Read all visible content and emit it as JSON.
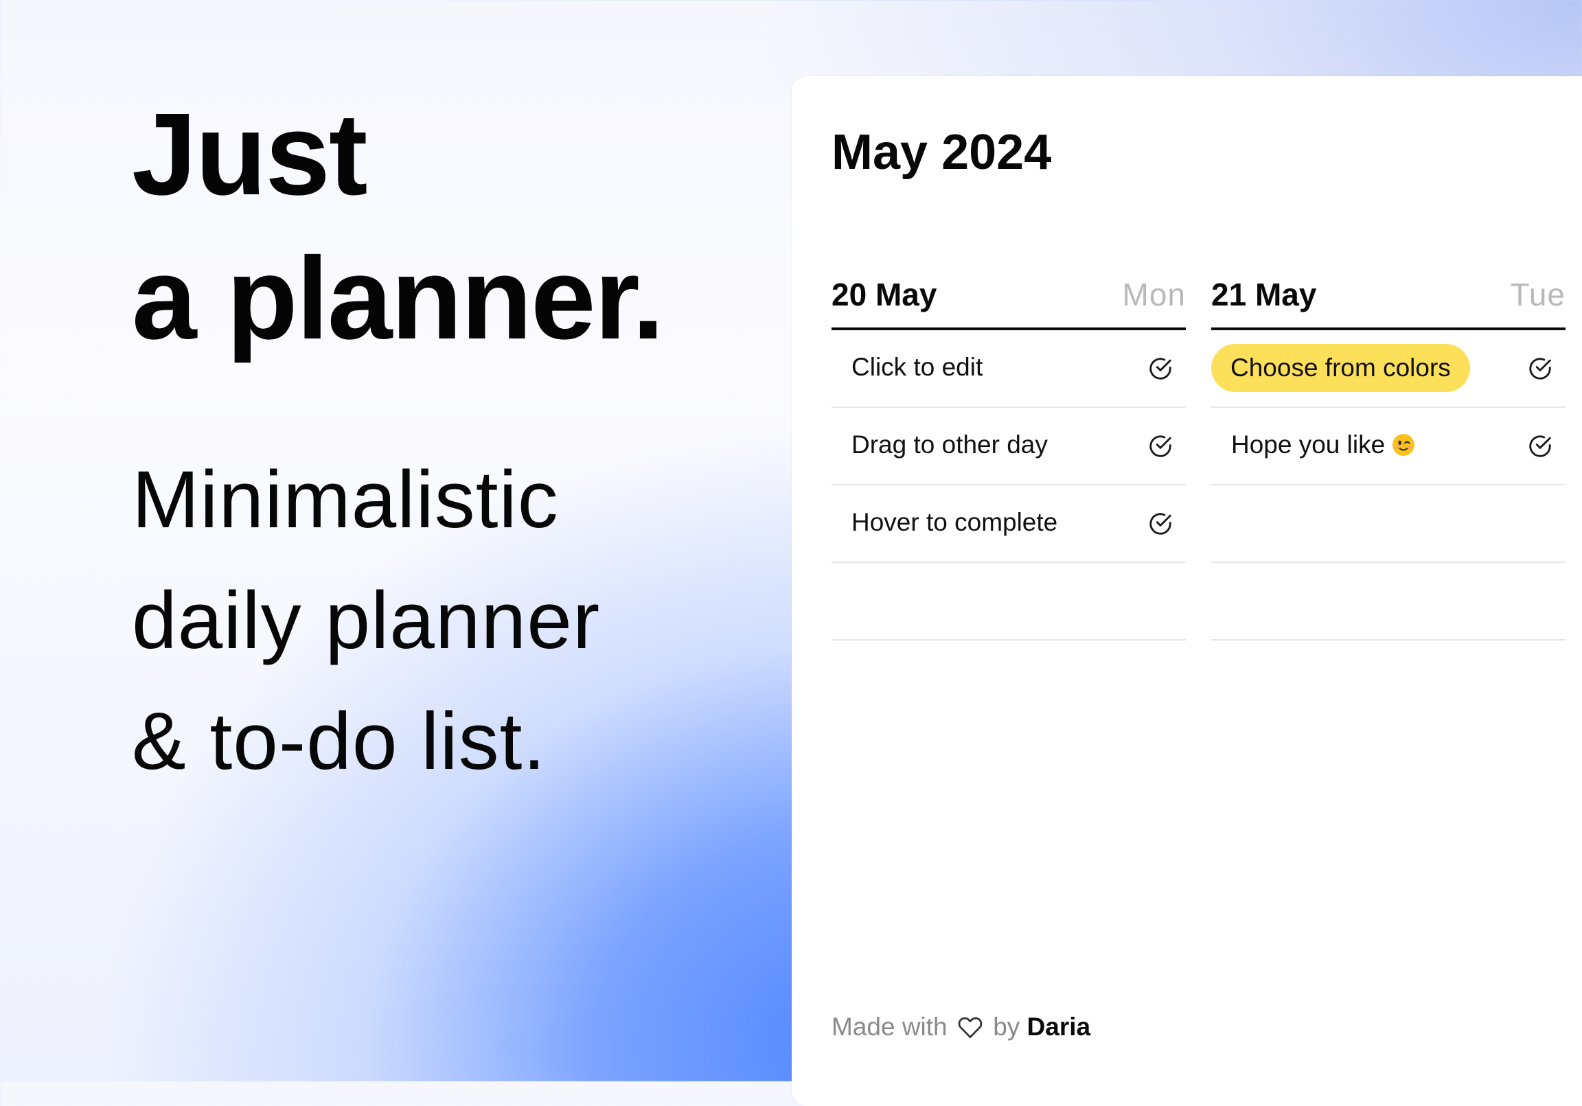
{
  "hero": {
    "title_lines": [
      "Just",
      "a planner."
    ],
    "subtitle_lines": [
      "Minimalistic",
      "daily planner",
      "& to-do list."
    ]
  },
  "planner": {
    "month_title": "May 2024",
    "days": [
      {
        "date": "20 May",
        "weekday": "Mon",
        "tasks": [
          {
            "text": "Click to edit",
            "highlight": null
          },
          {
            "text": "Drag to other day",
            "highlight": null
          },
          {
            "text": "Hover to complete",
            "highlight": null
          },
          {
            "text": "",
            "highlight": null
          }
        ]
      },
      {
        "date": "21 May",
        "weekday": "Tue",
        "tasks": [
          {
            "text": "Choose from colors",
            "highlight": "#fde05a"
          },
          {
            "text": "Hope you like",
            "emoji": "winking-face-emoji",
            "highlight": null
          },
          {
            "text": "",
            "highlight": null
          },
          {
            "text": "",
            "highlight": null
          }
        ]
      }
    ],
    "footer": {
      "prefix": "Made with",
      "icon": "heart-icon",
      "by": "by",
      "author": "Daria"
    }
  },
  "colors": {
    "accent_yellow": "#fde05a",
    "weekday_gray": "#b9b9b9",
    "background_blue": "#4f86ff"
  }
}
